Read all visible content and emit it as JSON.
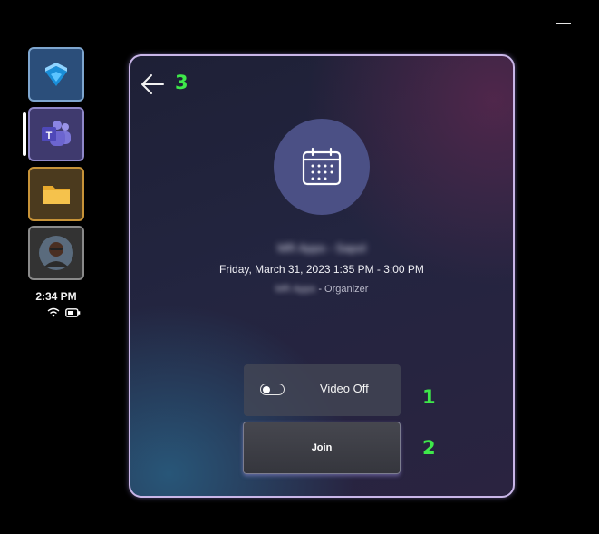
{
  "window": {
    "minimize_icon": "minimize-icon"
  },
  "rail": {
    "apps": [
      {
        "name": "dynamics",
        "icon": "dynamics-365-guides-icon"
      },
      {
        "name": "teams",
        "icon": "teams-icon",
        "badge_letter": "T",
        "active": true
      },
      {
        "name": "files",
        "icon": "folder-icon"
      },
      {
        "name": "profile",
        "icon": "avatar-icon"
      }
    ],
    "clock": "2:34 PM",
    "status_icons": [
      "wifi-icon",
      "battery-icon"
    ]
  },
  "meeting": {
    "back_icon": "arrow-left-icon",
    "calendar_icon": "calendar-icon",
    "title": "MR Apps - Sapol",
    "time": "Friday, March 31, 2023 1:35 PM - 3:00 PM",
    "organizer_name": "MR Apps",
    "organizer_suffix": " - Organizer",
    "video_toggle": {
      "label": "Video Off",
      "state": "off"
    },
    "join_label": "Join"
  },
  "annotations": {
    "one": "1",
    "two": "2",
    "three": "3"
  },
  "colors": {
    "annotation": "#3ee84a",
    "panel_border": "#c9b6e8",
    "calendar_circle": "#4b5085"
  }
}
